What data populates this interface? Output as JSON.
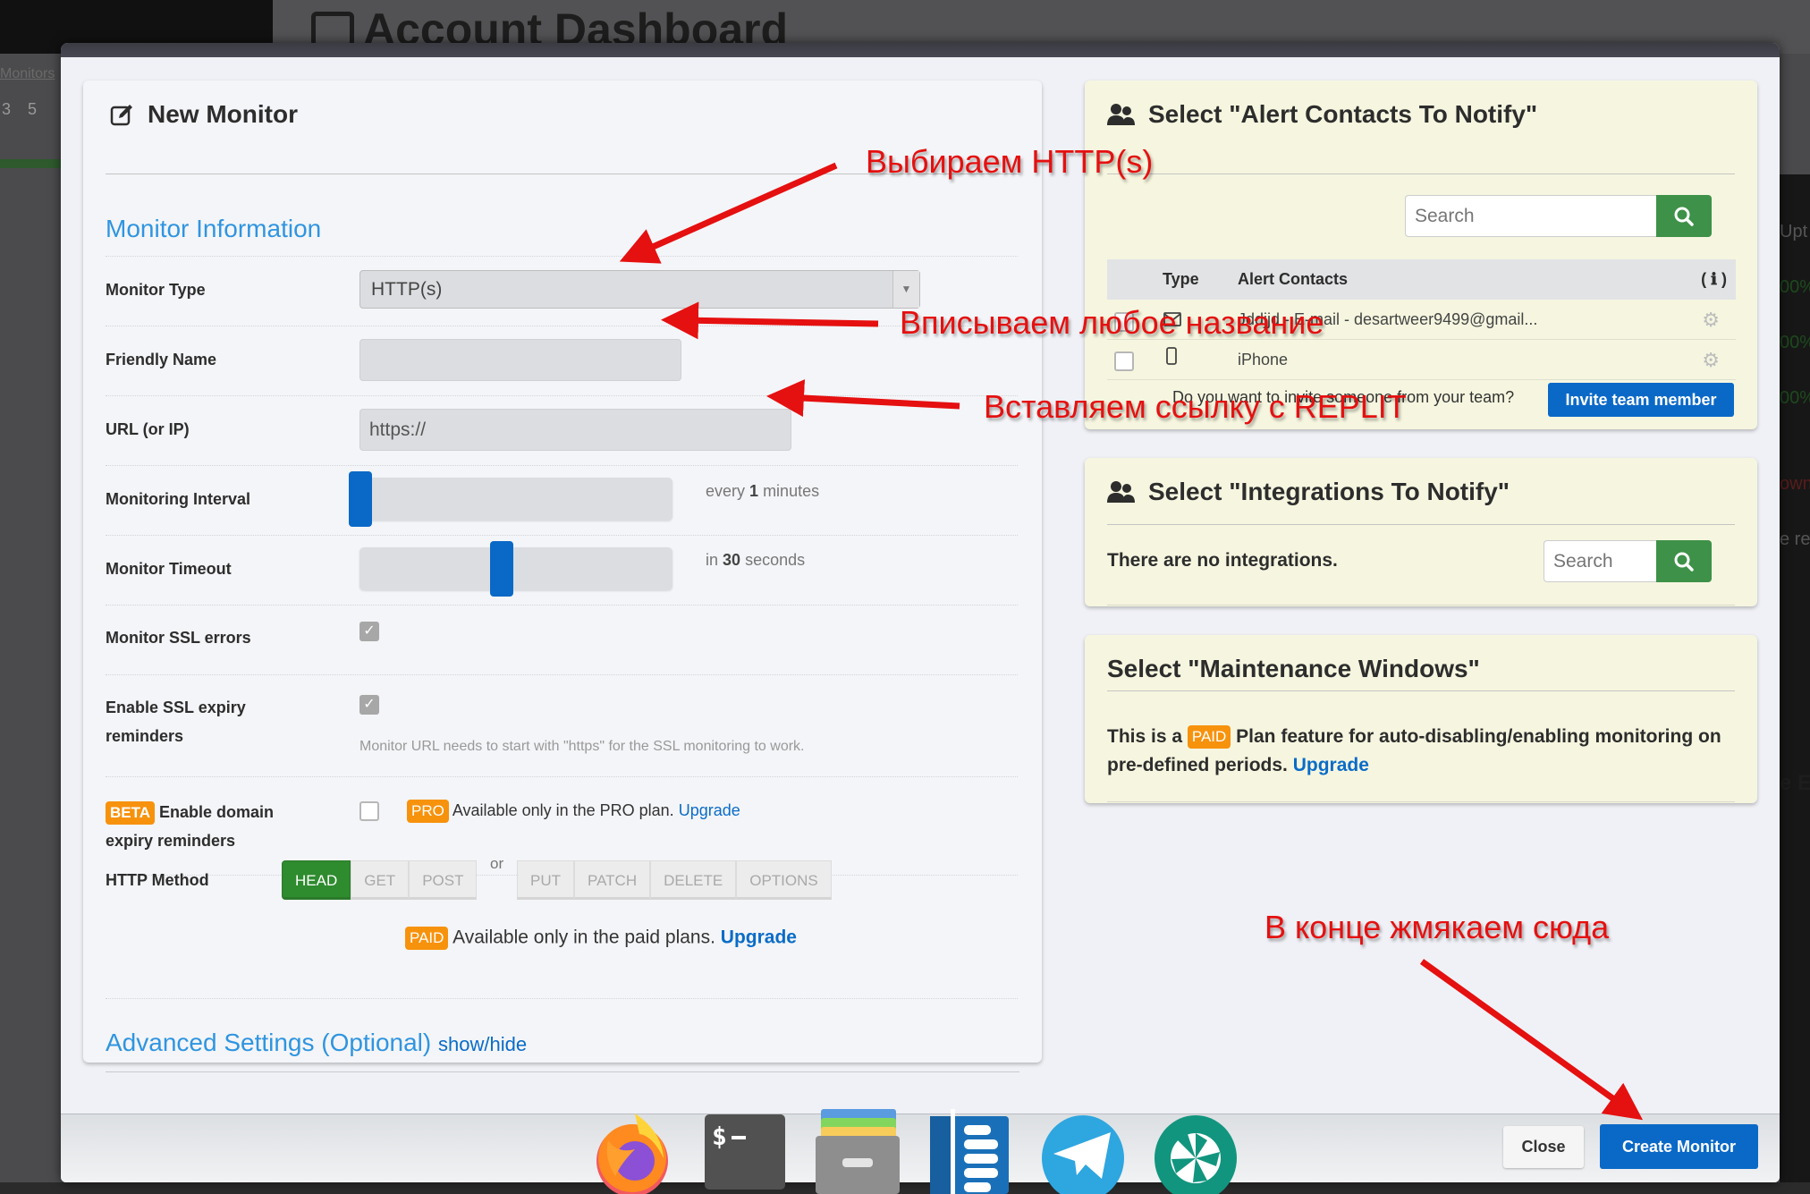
{
  "background": {
    "page_title": "Account Dashboard",
    "sidebar_link": "Monitors",
    "sidebar_counts": "3 5",
    "right_fragments": [
      "Upt",
      "00%",
      "00%",
      "00%",
      "own",
      "e rec",
      "e E"
    ]
  },
  "modal": {
    "left_panel": {
      "title": "New Monitor",
      "section_title": "Monitor Information",
      "monitor_type": {
        "label": "Monitor Type",
        "value": "HTTP(s)"
      },
      "friendly_name": {
        "label": "Friendly Name",
        "value": ""
      },
      "url": {
        "label": "URL (or IP)",
        "value": "https://"
      },
      "interval": {
        "label": "Monitoring Interval",
        "prefix": "every",
        "value": "1",
        "unit": "minutes",
        "slider_fraction": 0
      },
      "timeout": {
        "label": "Monitor Timeout",
        "prefix": "in",
        "value": "30",
        "unit": "seconds",
        "slider_fraction": 0.45
      },
      "ssl_errors": {
        "label": "Monitor SSL errors",
        "checked": true
      },
      "ssl_expiry": {
        "label_line1": "Enable SSL expiry",
        "label_line2": "reminders",
        "checked": true,
        "hint": "Monitor URL needs to start with \"https\" for the SSL monitoring to work."
      },
      "domain_expiry": {
        "badge": "BETA",
        "label_line1": "Enable domain",
        "label_line2": "expiry reminders",
        "checked": false,
        "pro_badge": "PRO",
        "pro_text": "Available only in the PRO plan.",
        "upgrade": "Upgrade"
      },
      "http_method": {
        "label": "HTTP Method",
        "group1": [
          "HEAD",
          "GET",
          "POST"
        ],
        "or": "or",
        "group2": [
          "PUT",
          "PATCH",
          "DELETE",
          "OPTIONS"
        ],
        "selected": "HEAD"
      },
      "paid_note": {
        "badge": "PAID",
        "text": "Available only in the paid plans.",
        "upgrade": "Upgrade"
      },
      "advanced": {
        "title": "Advanced Settings (Optional)",
        "toggle": "show/hide"
      }
    },
    "alert_contacts": {
      "title": "Select \"Alert Contacts To Notify\"",
      "search_placeholder": "Search",
      "columns": {
        "type": "Type",
        "contacts": "Alert Contacts",
        "info": "( ℹ )"
      },
      "rows": [
        {
          "type_icon": "envelope-icon",
          "name": "Jddjjd - E-mail - desartweer9499@gmail...",
          "checked": false
        },
        {
          "type_icon": "mobile-icon",
          "name": "iPhone",
          "checked": false
        }
      ],
      "invite_text": "Do you want to invite someone from your team?",
      "invite_button": "Invite team member"
    },
    "integrations": {
      "title": "Select \"Integrations To Notify\"",
      "empty_text": "There are no integrations.",
      "search_placeholder": "Search"
    },
    "maintenance": {
      "title": "Select \"Maintenance Windows\"",
      "text_before": "This is a",
      "badge": "PAID",
      "text_after": "Plan feature for auto-disabling/enabling monitoring on pre-defined periods.",
      "upgrade": "Upgrade"
    },
    "footer": {
      "close": "Close",
      "create": "Create Monitor"
    }
  },
  "annotations": [
    "Выбираем HTTP(s)",
    "Вписываем любое название",
    "Вставляем ссылку с REPLIT",
    "В конце жмякаем сюда"
  ],
  "dock": [
    "firefox",
    "terminal",
    "files",
    "text-editor",
    "telegram",
    "shutter"
  ],
  "colors": {
    "primary_blue": "#0a69c7",
    "section_blue": "#2f95e0",
    "green": "#3e9148",
    "badge_orange": "#f7920d",
    "annotation_red": "#e51010",
    "right_card_bg": "#f6f6e0"
  }
}
